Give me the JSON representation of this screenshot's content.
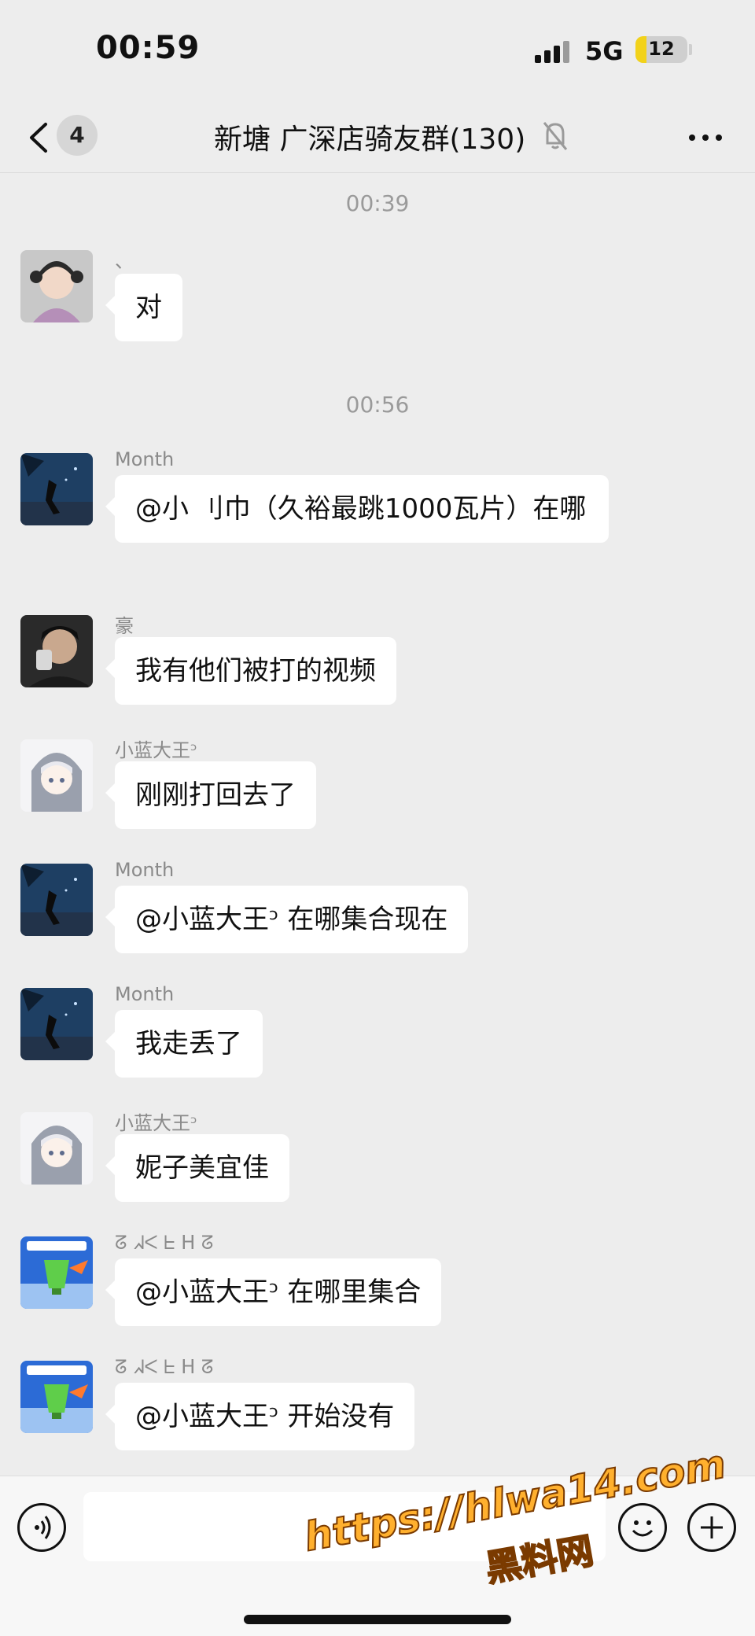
{
  "status_bar": {
    "time": "00:59",
    "network": "5G",
    "battery": "12",
    "battery_level": 0.12
  },
  "nav": {
    "back_badge": "4",
    "title": "新塘 广深店骑友群(130)",
    "icons": [
      "back-icon",
      "mute-icon",
      "more-icon"
    ]
  },
  "conversation": {
    "timestamps": [
      "00:39",
      "00:56"
    ],
    "messages": [
      {
        "sender": "、",
        "avatar": "girl-photo-avatar",
        "text": "对"
      },
      {
        "sender": "Month",
        "avatar": "night-scene-avatar",
        "text": "@小 刂巾（久裕最跳1000瓦片）在哪"
      },
      {
        "sender": "豪",
        "avatar": "boy-photo-avatar",
        "text": "我有他们被打的视频"
      },
      {
        "sender": "小蓝大王ᵓ",
        "avatar": "anime-girl-avatar",
        "text": "刚刚打回去了"
      },
      {
        "sender": "Month",
        "avatar": "night-scene-avatar",
        "text": "@小蓝大王ᵓ 在哪集合现在"
      },
      {
        "sender": "Month",
        "avatar": "night-scene-avatar",
        "text": "我走丢了"
      },
      {
        "sender": "小蓝大王ᵓ",
        "avatar": "anime-girl-avatar",
        "text": "妮子美宜佳"
      },
      {
        "sender": "ᘔ ᖽᐸ ᖶ ᕼ ᘔ",
        "avatar": "lantern-avatar",
        "text": "@小蓝大王ᵓ 在哪里集合"
      },
      {
        "sender": "ᘔ ᖽᐸ ᖶ ᕼ ᘔ",
        "avatar": "lantern-avatar",
        "text": "@小蓝大王ᵓ 开始没有"
      }
    ]
  },
  "input_bar": {
    "icons": [
      "voice-icon",
      "emoji-icon",
      "plus-icon"
    ]
  },
  "watermark": {
    "url": "https://hlwa14.com",
    "name": "黑料网"
  },
  "colors": {
    "background": "#ededed",
    "bubble": "#ffffff",
    "battery_fill": "#f2d21a",
    "watermark": "#ffb02e"
  }
}
